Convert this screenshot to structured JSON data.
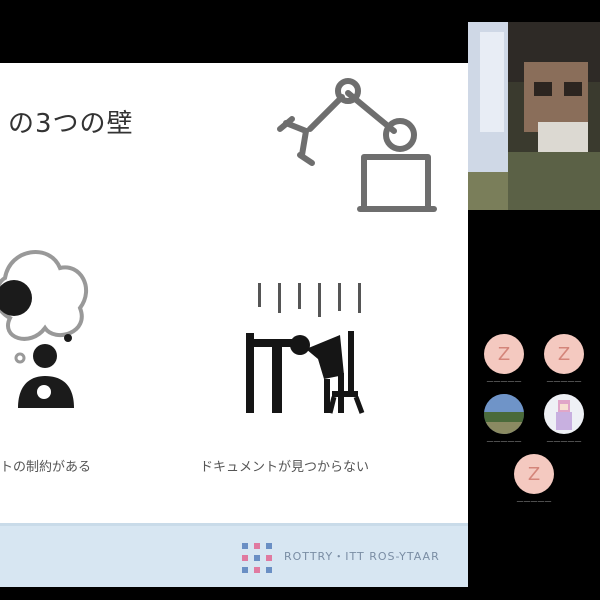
{
  "slide": {
    "title": "の3つの壁",
    "captions": {
      "left": "トの制約がある",
      "right": "ドキュメントが見つからない"
    },
    "footer_text": "ROTTRY・ITT ROS-YTAAR"
  },
  "participants": [
    {
      "initial": "Z",
      "name": "—————"
    },
    {
      "initial": "Z",
      "name": "—————"
    },
    {
      "initial": "",
      "name": "—————"
    },
    {
      "initial": "",
      "name": "—————"
    },
    {
      "initial": "Z",
      "name": "—————"
    }
  ],
  "colors": {
    "slide_bg": "#ffffff",
    "footer_bg": "#d7e6f2",
    "avatar_bg": "#f4c9c0",
    "avatar_text": "#d4857a"
  }
}
